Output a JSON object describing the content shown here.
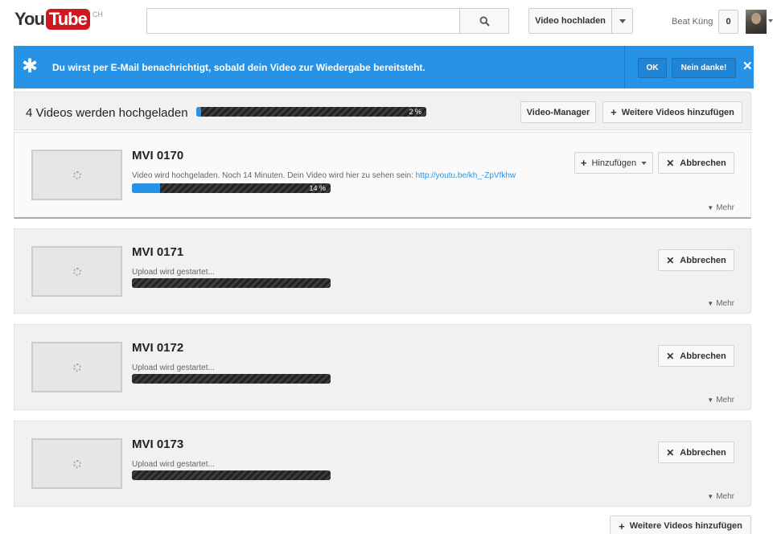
{
  "header": {
    "logo_you": "You",
    "logo_tube": "Tube",
    "logo_country": "CH",
    "search_placeholder": "",
    "upload_label": "Video hochladen",
    "username": "Beat Küng",
    "notification_count": "0"
  },
  "notice": {
    "text": "Du wirst per E-Mail benachrichtigt, sobald dein Video zur Wiedergabe bereitsteht.",
    "ok_label": "OK",
    "decline_label": "Nein danke!",
    "close_glyph": "✕"
  },
  "summary": {
    "title": "4 Videos werden hochgeladen",
    "progress_percent": 2,
    "progress_label": "2 %",
    "manager_label": "Video-Manager",
    "add_more_label": "Weitere Videos hinzufügen"
  },
  "videos": [
    {
      "title": "MVI 0170",
      "status": "Video wird hochgeladen. Noch 14 Minuten. Dein Video wird hier zu sehen sein:",
      "link": "http://youtu.be/kh_-ZpVfkhw",
      "progress_percent": 14,
      "progress_label": "14 %",
      "add_label": "Hinzufügen",
      "cancel_label": "Abbrechen",
      "more_label": "Mehr"
    },
    {
      "title": "MVI 0171",
      "status": "Upload wird gestartet...",
      "progress_percent": 0,
      "cancel_label": "Abbrechen",
      "more_label": "Mehr"
    },
    {
      "title": "MVI 0172",
      "status": "Upload wird gestartet...",
      "progress_percent": 0,
      "cancel_label": "Abbrechen",
      "more_label": "Mehr"
    },
    {
      "title": "MVI 0173",
      "status": "Upload wird gestartet...",
      "progress_percent": 0,
      "cancel_label": "Abbrechen",
      "more_label": "Mehr"
    }
  ],
  "footer": {
    "add_more_label": "Weitere Videos hinzufügen"
  },
  "colors": {
    "accent": "#2793e6",
    "logo_red": "#cc181e"
  }
}
